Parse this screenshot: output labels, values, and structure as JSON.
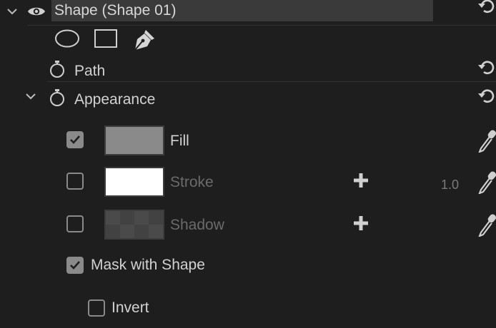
{
  "layer": {
    "name": "Shape (Shape 01)",
    "visibility_icon": "eye-icon",
    "reset_icon": "reset-icon"
  },
  "tools": [
    {
      "name": "ellipse-tool",
      "icon": "ellipse-icon"
    },
    {
      "name": "rectangle-tool",
      "icon": "rectangle-icon"
    },
    {
      "name": "pen-tool",
      "icon": "pen-icon"
    }
  ],
  "path": {
    "label": "Path",
    "stopwatch_icon": "stopwatch-icon"
  },
  "appearance": {
    "label": "Appearance",
    "stopwatch_icon": "stopwatch-icon",
    "fill": {
      "label": "Fill",
      "checked": true,
      "color": "#8a8a8a"
    },
    "stroke": {
      "label": "Stroke",
      "checked": false,
      "color": "#ffffff",
      "width": "1.0"
    },
    "shadow": {
      "label": "Shadow",
      "checked": false,
      "color": "#4a4a4a"
    },
    "mask_with_shape": {
      "label": "Mask with Shape",
      "checked": true
    },
    "invert": {
      "label": "Invert",
      "checked": false
    }
  }
}
